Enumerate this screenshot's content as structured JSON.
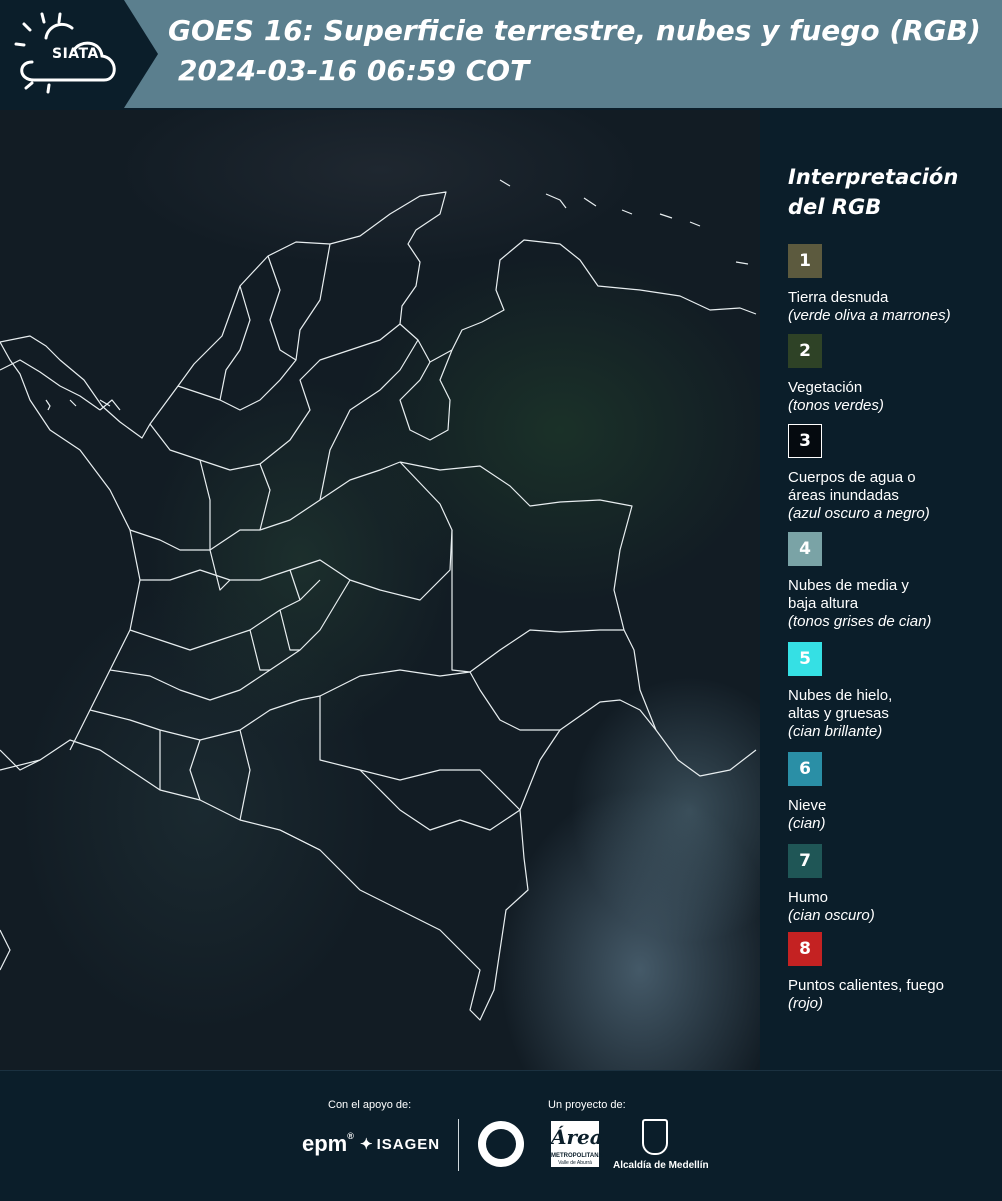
{
  "header": {
    "logo_text": "SIATA",
    "title_line1": "GOES 16: Superficie terrestre, nubes y fuego (RGB)",
    "title_line2": "2024-03-16 06:59 COT"
  },
  "legend": {
    "title_line1": "Interpretación",
    "title_line2": "del RGB",
    "items": [
      {
        "number": "1",
        "label": "Tierra desnuda",
        "desc": "(verde oliva a marrones)",
        "color": "#5c5a3e"
      },
      {
        "number": "2",
        "label": "Vegetación",
        "desc": "(tonos verdes)",
        "color": "#2e4226"
      },
      {
        "number": "3",
        "label": "Cuerpos de agua o áreas inundadas",
        "desc": "(azul oscuro a negro)",
        "color": "#050a0f"
      },
      {
        "number": "4",
        "label": "Nubes de media y baja altura",
        "desc": "(tonos grises de cian)",
        "color": "#7aa3a6"
      },
      {
        "number": "5",
        "label": "Nubes de hielo, altas y gruesas",
        "desc": "(cian brillante)",
        "color": "#35e0e4"
      },
      {
        "number": "6",
        "label": "Nieve",
        "desc": "(cian)",
        "color": "#2a8fa6"
      },
      {
        "number": "7",
        "label": "Humo",
        "desc": "(cian oscuro)",
        "color": "#1f5656"
      },
      {
        "number": "8",
        "label": "Puntos calientes, fuego",
        "desc": "(rojo)",
        "color": "#c42222"
      }
    ]
  },
  "footer": {
    "support_label": "Con el apoyo de:",
    "project_label": "Un proyecto de:",
    "epm": "epm",
    "isagen": "ISAGEN",
    "area_big": "Área",
    "area_small": "METROPOLITANA",
    "area_small2": "Valle de Aburrá",
    "medellin": "Alcaldía de Medellín"
  }
}
